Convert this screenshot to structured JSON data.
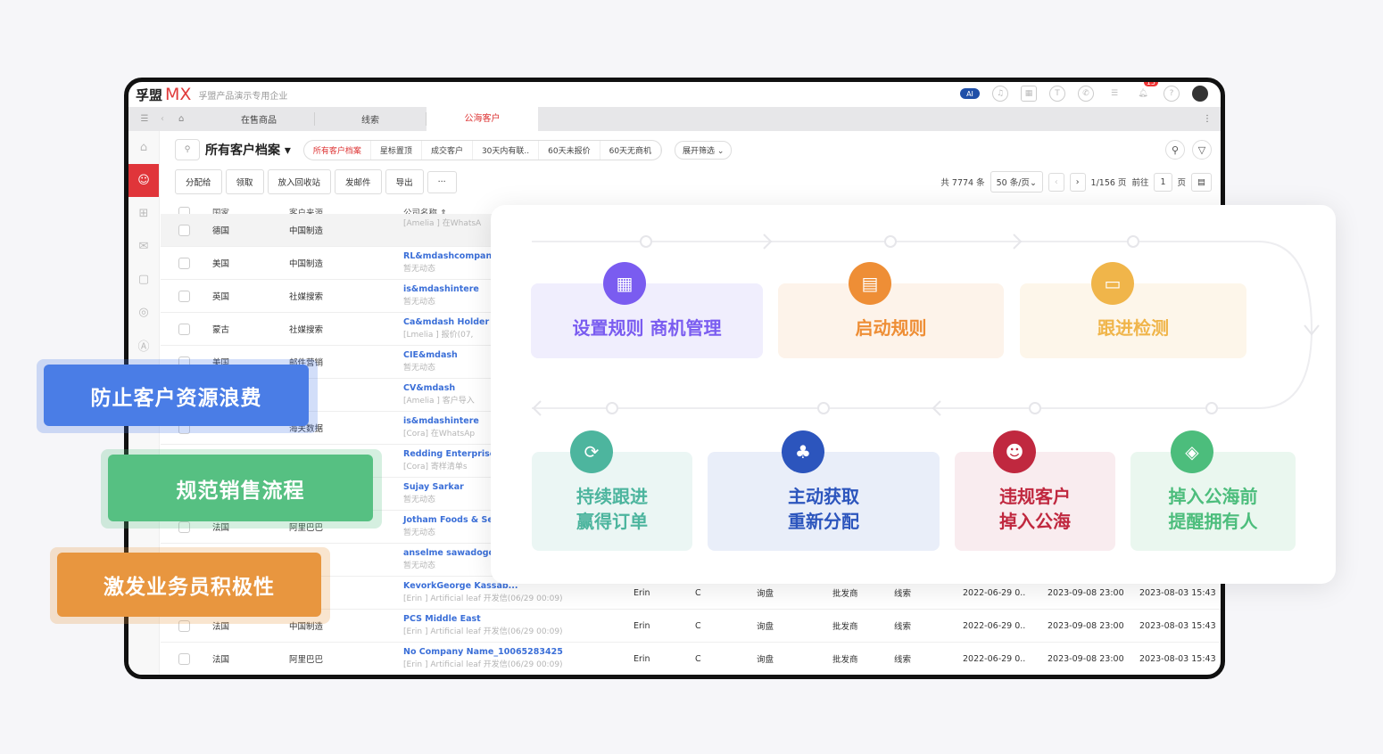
{
  "header": {
    "logo_cn": "孚盟",
    "logo_mx": "MX",
    "org": "孚盟产品演示专用企业",
    "ai": "AI",
    "notif_count": "15"
  },
  "tabs": [
    "在售商品",
    "线索",
    "公海客户"
  ],
  "toolbar": {
    "title": "所有客户档案",
    "filters": [
      "所有客户档案",
      "星标置顶",
      "成交客户",
      "30天内有联..",
      "60天未报价",
      "60天无商机"
    ],
    "expand": "展开筛选"
  },
  "actions": {
    "buttons": [
      "分配给",
      "领取",
      "放入回收站",
      "发邮件",
      "导出",
      "···"
    ],
    "total": "共 7774 条",
    "per_page": "50 条/页",
    "page": "1/156 页",
    "goto": "前往",
    "goto_value": "1",
    "page_unit": "页"
  },
  "columns": {
    "country": "国家",
    "source": "客户来源",
    "company": "公司名称"
  },
  "rows": [
    {
      "country": "德国",
      "source": "中国制造",
      "name": "",
      "sub": "[Amelia ] 在WhatsA"
    },
    {
      "country": "美国",
      "source": "中国制造",
      "name": "RL&mdashcompani",
      "sub": "暂无动态"
    },
    {
      "country": "英国",
      "source": "社媒搜索",
      "name": "is&mdashintere",
      "sub": "暂无动态"
    },
    {
      "country": "蒙古",
      "source": "社媒搜索",
      "name": "Ca&mdash Holder C",
      "sub": "[Lmelia ] 报价(07,"
    },
    {
      "country": "美国",
      "source": "邮件营销",
      "name": "CIE&mdash",
      "sub": "暂无动态"
    },
    {
      "country": "",
      "source": "",
      "name": "CV&mdash",
      "sub": "[Amelia ] 客户导入"
    },
    {
      "country": "",
      "source": "海关数据",
      "name": "is&mdashintere",
      "sub": "[Cora] 在WhatsAp"
    },
    {
      "country": "",
      "source": "",
      "name": "Redding Enterprises",
      "sub": "[Cora] 寄样清单s"
    },
    {
      "country": "",
      "source": "",
      "name": "Sujay Sarkar",
      "sub": "暂无动态"
    },
    {
      "country": "法国",
      "source": "阿里巴巴",
      "name": "Jotham Foods & Ser",
      "sub": "暂无动态"
    },
    {
      "country": "",
      "source": "",
      "name": "anselme sawadogo",
      "sub": "暂无动态"
    },
    {
      "country": "",
      "source": "",
      "name": "KevorkGeorge Kassab...",
      "sub": "[Erin ] Artificial leaf 开发信(06/29 00:09)",
      "owner": "Erin",
      "grade": "C",
      "stage": "询盘",
      "type": "批发商",
      "origin": "线索",
      "d1": "2022-06-29 0..",
      "d2": "2023-09-08 23:00",
      "d3": "2023-08-03 15:43"
    },
    {
      "country": "法国",
      "source": "中国制造",
      "name": "PCS Middle East",
      "sub": "[Erin ] Artificial leaf 开发信(06/29 00:09)",
      "owner": "Erin",
      "grade": "C",
      "stage": "询盘",
      "type": "批发商",
      "origin": "线索",
      "d1": "2022-06-29 0..",
      "d2": "2023-09-08 23:00",
      "d3": "2023-08-03 15:43"
    },
    {
      "country": "法国",
      "source": "阿里巴巴",
      "name": "No Company Name_10065283425",
      "sub": "[Erin ] Artificial leaf 开发信(06/29 00:09)",
      "owner": "Erin",
      "grade": "C",
      "stage": "询盘",
      "type": "批发商",
      "origin": "线索",
      "d1": "2022-06-29 0..",
      "d2": "2023-09-08 23:00",
      "d3": "2023-08-03 15:43"
    }
  ],
  "flow": {
    "steps": [
      {
        "label": "设置规则 商机管理",
        "color": "#7a5cf0",
        "bg": "#f0eefd",
        "icon": "grid-icon"
      },
      {
        "label": "启动规则",
        "color": "#ee8e36",
        "bg": "#fdf3ea",
        "icon": "document-gear-icon"
      },
      {
        "label": "跟进检测",
        "color": "#f0b54a",
        "bg": "#fdf6ea",
        "icon": "monitor-icon"
      },
      {
        "label": "持续跟进\n赢得订单",
        "color": "#4db59e",
        "bg": "#ebf6f4",
        "icon": "refresh-icon"
      },
      {
        "label": "主动获取\n重新分配",
        "color": "#2c55bd",
        "bg": "#e9eef9",
        "icon": "org-chart-icon"
      },
      {
        "label": "违规客户\n掉入公海",
        "color": "#c0283f",
        "bg": "#f9ecef",
        "icon": "user-alert-icon"
      },
      {
        "label": "掉入公海前\n提醒拥有人",
        "color": "#4cbd7c",
        "bg": "#eaf7ef",
        "icon": "bell-doc-icon"
      }
    ]
  },
  "highlights": [
    {
      "label": "防止客户资源浪费",
      "color": "#4a7de6"
    },
    {
      "label": "规范销售流程",
      "color": "#56c082"
    },
    {
      "label": "激发业务员积极性",
      "color": "#e8963f"
    }
  ]
}
